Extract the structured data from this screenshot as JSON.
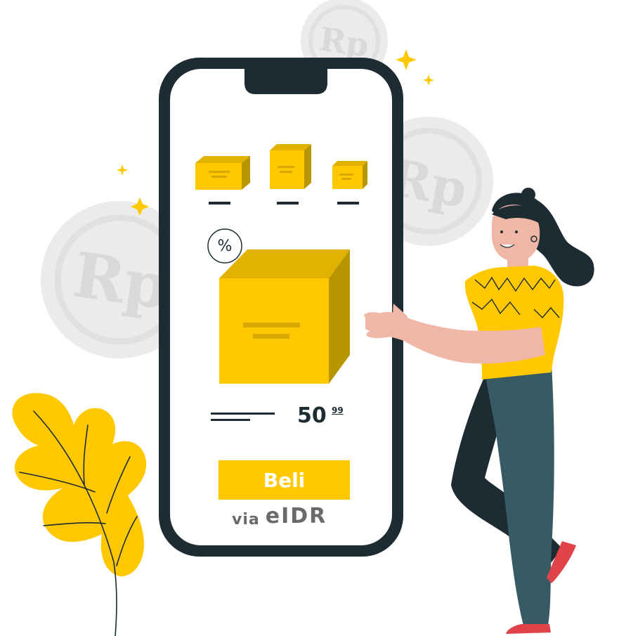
{
  "coins": {
    "label": "Rp"
  },
  "product": {
    "price_integer": "50",
    "price_decimal": "99",
    "discount_symbol": "%"
  },
  "buy_button": {
    "label": "Beli"
  },
  "payment": {
    "via_text": "via",
    "brand": "eIDR"
  },
  "colors": {
    "accent": "#ffc800",
    "accent_dark": "#b89600",
    "phone_frame": "#1d2b33",
    "coin": "#ebebeb",
    "skin": "#f0b6a6",
    "pants": "#375a64",
    "shoe": "#e0424a"
  },
  "icons": {
    "percent": "percent-badge-icon",
    "sparkle": "sparkle-icon"
  }
}
